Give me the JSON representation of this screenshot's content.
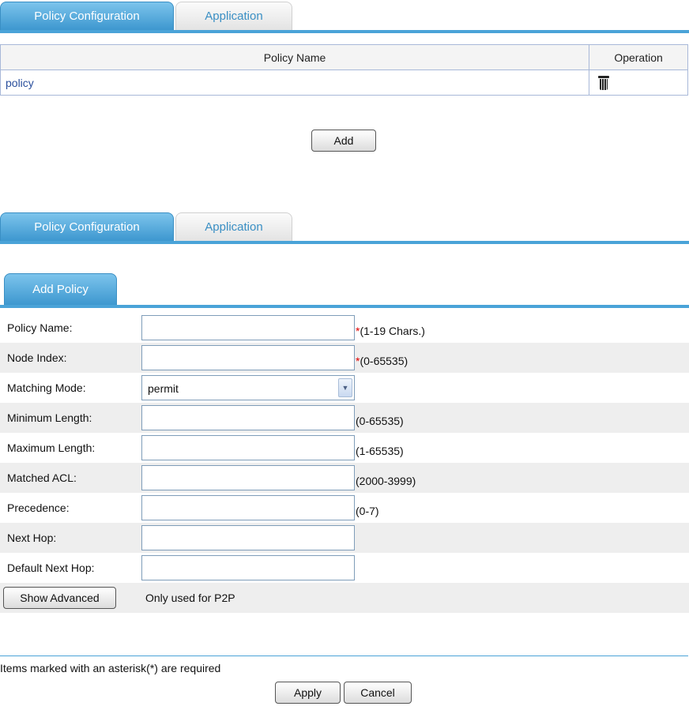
{
  "top_tabs": {
    "active": "Policy Configuration",
    "inactive": "Application"
  },
  "table": {
    "headers": [
      "Policy Name",
      "Operation"
    ],
    "rows": [
      {
        "name": "policy"
      }
    ]
  },
  "add_button": "Add",
  "bottom_tabs": {
    "active": "Policy Configuration",
    "inactive": "Application"
  },
  "sub_tab": "Add Policy",
  "form": {
    "fields": [
      {
        "label": "Policy Name:",
        "value": "",
        "required": true,
        "hint": "(1-19 Chars.)"
      },
      {
        "label": "Node Index:",
        "value": "",
        "required": true,
        "hint": "(0-65535)"
      },
      {
        "label": "Matching Mode:",
        "type": "select",
        "value": "permit"
      },
      {
        "label": "Minimum Length:",
        "value": "",
        "hint": "(0-65535)"
      },
      {
        "label": "Maximum Length:",
        "value": "",
        "hint": "(1-65535)"
      },
      {
        "label": "Matched ACL:",
        "value": "",
        "hint": "(2000-3999)"
      },
      {
        "label": "Precedence:",
        "value": "",
        "hint": "(0-7)"
      },
      {
        "label": "Next Hop:",
        "value": ""
      },
      {
        "label": "Default Next Hop:",
        "value": ""
      }
    ],
    "star": "*",
    "show_advanced": "Show Advanced",
    "advanced_note": "Only used for P2P"
  },
  "required_note": "Items marked with an asterisk(*) are required",
  "apply_button": "Apply",
  "cancel_button": "Cancel",
  "colors": {
    "accent": "#4aa3d8",
    "link": "#2a4f9c",
    "required": "#e00000"
  },
  "icons": {
    "delete": "trash-icon",
    "dropdown": "chevron-down-icon"
  }
}
